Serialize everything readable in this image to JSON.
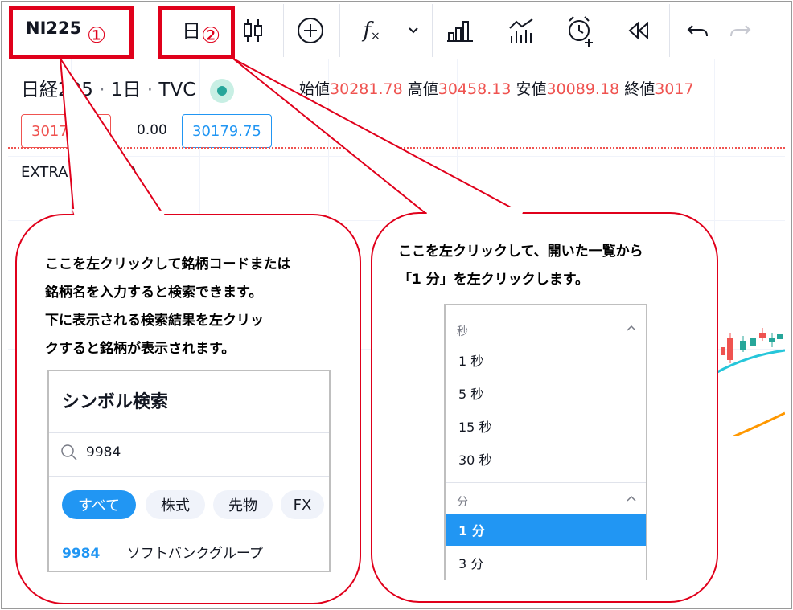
{
  "toolbar": {
    "symbol": "NI225",
    "interval": "日",
    "badge1": "①",
    "badge2": "②",
    "icons": [
      "candles-icon",
      "plus-circle-icon",
      "fx-icon",
      "chevron-down-icon",
      "bar-chart-icon",
      "indicator-chart-icon",
      "alarm-add-icon",
      "replay-icon",
      "undo-icon",
      "redo-icon"
    ]
  },
  "legend": {
    "name": "日経225",
    "interval": "1日",
    "source": "TVC",
    "open_label": "始値",
    "open": "30281.78",
    "high_label": "高値",
    "high": "30458.13",
    "low_label": "安値",
    "low": "30089.18",
    "close_label": "終値",
    "close": "3017"
  },
  "price_pills": {
    "left": "30179.75",
    "change": "0.00",
    "right": "30179.75"
  },
  "indicator": "EXTRA Ver.1.0.0",
  "bubble1": {
    "lines": [
      "ここを左クリックして銘柄コードまたは",
      "銘柄名を入力すると検索できます。",
      "下に表示される検索結果を左クリッ",
      "クすると銘柄が表示されます。"
    ]
  },
  "bubble2": {
    "lines": [
      "ここを左クリックして、開いた一覧から",
      "「1 分」を左クリックします。"
    ]
  },
  "symbol_search": {
    "title": "シンボル検索",
    "query": "9984",
    "chips": [
      "すべて",
      "株式",
      "先物",
      "FX"
    ],
    "result_code": "9984",
    "result_name": "ソフトバンクグループ"
  },
  "interval_menu": {
    "sec_header": "秒",
    "sec_items": [
      "1 秒",
      "5 秒",
      "15 秒",
      "30 秒"
    ],
    "min_header": "分",
    "min_items": [
      "1 分",
      "3 分"
    ],
    "selected": "1 分"
  },
  "colors": {
    "accent": "#2196f3",
    "callout": "#e0001b",
    "down": "#ef5350",
    "up": "#26a69a"
  }
}
